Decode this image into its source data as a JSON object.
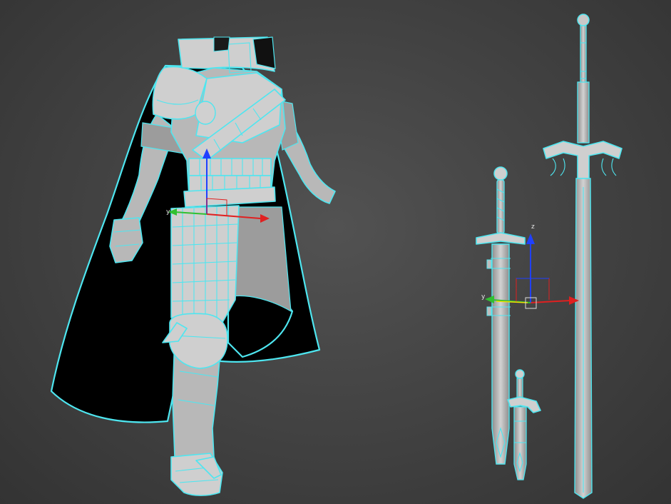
{
  "viewport": {
    "background": "#444444",
    "selection_color": "#4ee6f0"
  },
  "gizmo_character": {
    "x_label": "",
    "y_label": "y",
    "z_label": "",
    "x_color": "#e02020",
    "y_color": "#30c030",
    "z_color": "#2040ff"
  },
  "gizmo_swords": {
    "x_label": "",
    "y_label": "y",
    "z_label": "z",
    "x_color": "#e02020",
    "y_color": "#30c030",
    "z_color": "#2040ff"
  }
}
